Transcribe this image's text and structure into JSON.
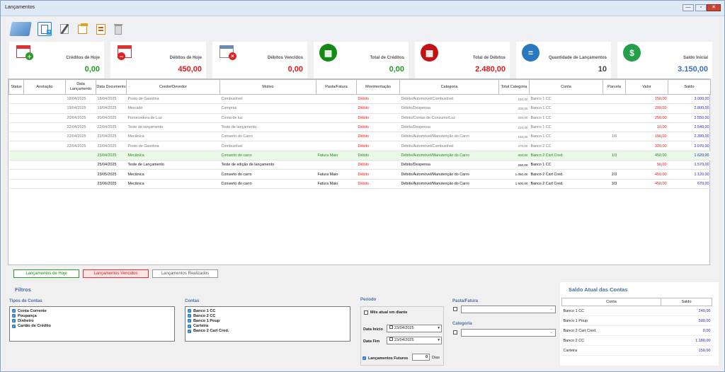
{
  "window": {
    "title": "Lançamentos",
    "minimize": "—",
    "maximize": "▫",
    "close": "✕"
  },
  "toolbar": {
    "icons": [
      "calendar-money-icon",
      "add-document-icon",
      "edit-icon",
      "export-icon",
      "report-icon",
      "delete-icon"
    ]
  },
  "summary": [
    {
      "label": "Créditos de Hoje",
      "value": "0,00",
      "color": "#1e9e1e"
    },
    {
      "label": "Débitos de Hoje",
      "value": "450,00",
      "color": "#e01818"
    },
    {
      "label": "Débitos Vencidos",
      "value": "0,00",
      "color": "#e01818"
    },
    {
      "label": "Total de Créditos",
      "value": "0,00",
      "color": "#1e9e1e"
    },
    {
      "label": "Total de Débitos",
      "value": "2.480,00",
      "color": "#e01818"
    },
    {
      "label": "Quantidade de Lançamentos",
      "value": "10",
      "color": "#444444"
    },
    {
      "label": "Saldo Inicial",
      "value": "3.150,00",
      "color": "#3a6fc4"
    }
  ],
  "table": {
    "headers": [
      "Status",
      "Anotação",
      "Data Lançamento",
      "Data Documento",
      "Credor/Devedor",
      "Motivo",
      "Pasta/Fatura",
      "Movimentação",
      "Categoria",
      "Total Categoria",
      "Conta",
      "Parcela",
      "Valor",
      "Saldo"
    ],
    "rows": [
      {
        "kind": "past",
        "c": [
          "",
          "",
          "18/04/2025",
          "18/04/2025",
          "Posto de Gasolina",
          "Combustível",
          "",
          "Débito",
          "Débito/Automóvel/Combustível",
          "150,00",
          "Banco 1 CC",
          "",
          "150,00",
          "3.000,00"
        ]
      },
      {
        "kind": "past",
        "c": [
          "",
          "",
          "19/04/2025",
          "19/04/2025",
          "Mercado",
          "Compras",
          "",
          "Débito",
          "Débito/Despensa",
          "200,00",
          "Banco 1 CC",
          "",
          "200,00",
          "2.800,00"
        ]
      },
      {
        "kind": "past",
        "c": [
          "",
          "",
          "20/04/2025",
          "20/04/2025",
          "Fornecedora de Luz",
          "Conta de luz",
          "",
          "Débito",
          "Débito/Contas de Consumo/Luz",
          "250,00",
          "Banco 1 CC",
          "",
          "250,00",
          "2.550,00"
        ]
      },
      {
        "kind": "past",
        "c": [
          "",
          "",
          "22/04/2025",
          "22/04/2025",
          "Teste de lançamento",
          "Teste de lançamento",
          "",
          "Débito",
          "Débito/Despensa",
          "210,00",
          "Banco 1 CC",
          "",
          "10,00",
          "2.540,00"
        ]
      },
      {
        "kind": "past",
        "c": [
          "",
          "",
          "22/04/2025",
          "22/04/2025",
          "Mecânica",
          "Conserto do Carro",
          "",
          "Débito",
          "Débito/Automóvel/Manutenção do Carro",
          "150,00",
          "Banco 1 CC",
          "1/6",
          "150,00",
          "2.390,00"
        ]
      },
      {
        "kind": "past",
        "c": [
          "",
          "",
          "22/04/2025",
          "22/04/2025",
          "Posto de Gasolina",
          "Combustível",
          "",
          "Débito",
          "Débito/Automóvel/Combustível",
          "470,00",
          "Banco 2 CC",
          "",
          "320,00",
          "2.070,00"
        ]
      },
      {
        "kind": "today",
        "c": [
          "",
          "",
          "",
          "23/04/2025",
          "Mecânica",
          "Conserto do carro",
          "Fatura Maio",
          "Débito",
          "Débito/Automóvel/Manutenção do Carro",
          "600,00",
          "Banco 2 Cart Cred.",
          "1/3",
          "450,00",
          "1.620,00"
        ]
      },
      {
        "kind": "future",
        "c": [
          "",
          "",
          "",
          "25/04/2025",
          "Teste de Lançamento",
          "Teste de edição de lançamento",
          "",
          "Débito",
          "Débito/Despensa",
          "260,00",
          "Banco 1 CC",
          "",
          "50,00",
          "1.570,00"
        ]
      },
      {
        "kind": "future",
        "c": [
          "",
          "",
          "",
          "23/05/2025",
          "Mecânica",
          "Conserto do carro",
          "Fatura Maio",
          "Débito",
          "Débito/Automóvel/Manutenção do Carro",
          "1.050,00",
          "Banco 2 Cart Cred.",
          "2/3",
          "450,00",
          "1.120,00"
        ]
      },
      {
        "kind": "future",
        "c": [
          "",
          "",
          "",
          "23/06/2025",
          "Mecânica",
          "Conserto do carro",
          "Fatura Maio",
          "Débito",
          "Débito/Automóvel/Manutenção do Carro",
          "1.500,00",
          "Banco 2 Cart Cred.",
          "3/3",
          "450,00",
          "670,00"
        ]
      }
    ]
  },
  "tabs": {
    "today": "Lançamentos de Hoje",
    "overdue": "Lançamentos Vencidos",
    "done": "Lançamentos Realizados"
  },
  "filters": {
    "title": "Filtros",
    "tipos_title": "Tipos de Contas",
    "tipos": [
      "Conta Corrente",
      "Poupança",
      "Dinheiro",
      "Cartão de Crédito"
    ],
    "contas_title": "Contas",
    "contas": [
      "Banco 1 CC",
      "Banco 2 CC",
      "Banco 1 Poup",
      "Carteira",
      "Banco 2 Cart Cred."
    ],
    "periodo_title": "Período",
    "mes_atual": "Mês atual em diante",
    "data_inicio_label": "Data Início",
    "data_inicio": "23/04/2025",
    "data_fim_label": "Data Fim",
    "data_fim": "23/04/2025",
    "futuros_label": "Lançamentos Futuros",
    "futuros_dias": "0",
    "dias_label": "Dias",
    "pasta_title": "Pasta/Fatura",
    "categoria_title": "Categoria"
  },
  "saldo": {
    "title": "Saldo Atual das Contas",
    "headers": [
      "Conta",
      "Saldo"
    ],
    "rows": [
      [
        "Banco 1 CC",
        "240,00"
      ],
      [
        "Banco 1 Poup",
        "500,00"
      ],
      [
        "Banco 2 Cart Cred.",
        "0,00"
      ],
      [
        "Banco 2 CC",
        "1.180,00"
      ],
      [
        "Carteira",
        "150,00"
      ]
    ]
  }
}
